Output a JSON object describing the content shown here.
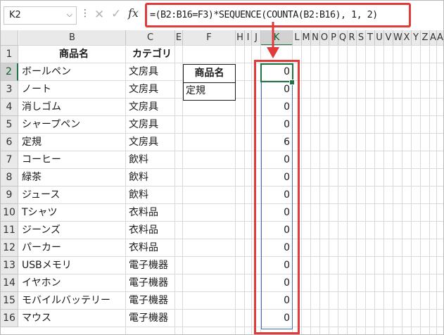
{
  "name_box": {
    "value": "K2",
    "chevron_icon": "chevron-down-icon"
  },
  "formula_bar": {
    "cancel_icon": "close-icon",
    "enter_icon": "check-icon",
    "function_label": "fx",
    "formula": "=(B2:B16=F3)*SEQUENCE(COUNTA(B2:B16), 1, 2)"
  },
  "columns": [
    "B",
    "C",
    "E",
    "F",
    "H",
    "I",
    "J",
    "K",
    "L",
    "M",
    "N",
    "O",
    "P",
    "Q",
    "R",
    "S",
    "T",
    "U",
    "V",
    "W",
    "X",
    "Y",
    "Z",
    "A",
    "A",
    "A"
  ],
  "rows": [
    "1",
    "2",
    "3",
    "4",
    "5",
    "6",
    "7",
    "8",
    "9",
    "10",
    "11",
    "12",
    "13",
    "14",
    "15",
    "16"
  ],
  "headers": {
    "b": "商品名",
    "c": "カテゴリ"
  },
  "products": [
    {
      "name": "ボールペン",
      "category": "文房具"
    },
    {
      "name": "ノート",
      "category": "文房具"
    },
    {
      "name": "消しゴム",
      "category": "文房具"
    },
    {
      "name": "シャープペン",
      "category": "文房具"
    },
    {
      "name": "定規",
      "category": "文房具"
    },
    {
      "name": "コーヒー",
      "category": "飲料"
    },
    {
      "name": "緑茶",
      "category": "飲料"
    },
    {
      "name": "ジュース",
      "category": "飲料"
    },
    {
      "name": "Tシャツ",
      "category": "衣料品"
    },
    {
      "name": "ジーンズ",
      "category": "衣料品"
    },
    {
      "name": "パーカー",
      "category": "衣料品"
    },
    {
      "name": "USBメモリ",
      "category": "電子機器"
    },
    {
      "name": "イヤホン",
      "category": "電子機器"
    },
    {
      "name": "モバイルバッテリー",
      "category": "電子機器"
    },
    {
      "name": "マウス",
      "category": "電子機器"
    }
  ],
  "lookup": {
    "header": "商品名",
    "value": "定規"
  },
  "results": [
    "0",
    "0",
    "0",
    "0",
    "6",
    "0",
    "0",
    "0",
    "0",
    "0",
    "0",
    "0",
    "0",
    "0",
    "0"
  ],
  "accent_colors": {
    "highlight": "#e03a3a",
    "selection": "#217346",
    "spill": "#3b6fb6"
  }
}
